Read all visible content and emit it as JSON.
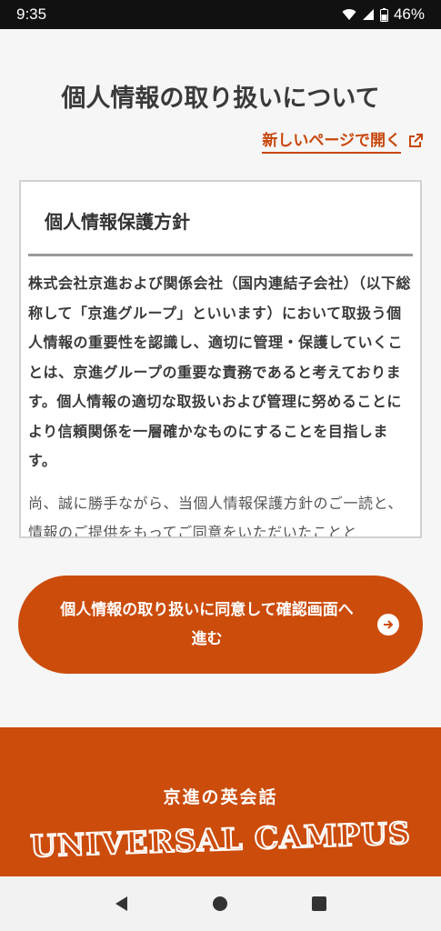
{
  "status_bar": {
    "time": "9:35",
    "battery": "46%"
  },
  "page": {
    "title": "個人情報の取り扱いについて",
    "open_link": "新しいページで開く"
  },
  "policy": {
    "heading": "個人情報保護方針",
    "paragraph1": "株式会社京進および関係会社（国内連結子会社）（以下総称して「京進グループ」といいます）において取扱う個人情報の重要性を認識し、適切に管理・保護していくことは、京進グループの重要な責務であると考えております。個人情報の適切な取扱いおよび管理に努めることにより信頼関係を一層確かなものにすることを目指します。",
    "paragraph2": "尚、誠に勝手ながら、当個人情報保護方針のご一読と、情報のご提供をもってご同意をいただいたことと"
  },
  "agree_button": {
    "label": "個人情報の取り扱いに同意して確認画面へ進む"
  },
  "footer": {
    "logo_small": "京進の英会話",
    "logo_big": "UNIVERSAL CAMPUS"
  },
  "colors": {
    "accent": "#cc4c0c"
  }
}
